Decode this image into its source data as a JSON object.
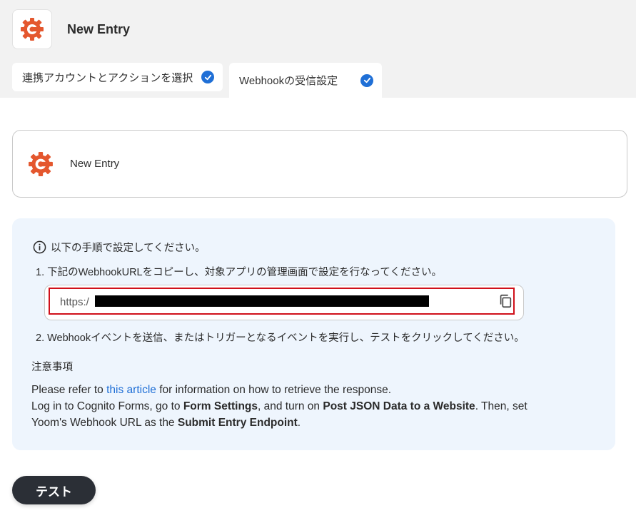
{
  "header": {
    "app_title": "New Entry",
    "brand_color": "#e4572e"
  },
  "tabs": [
    {
      "label": "連携アカウントとアクションを選択",
      "done": true
    },
    {
      "label": "Webhookの受信設定",
      "done": true
    }
  ],
  "trigger_card": {
    "title": "New Entry"
  },
  "instructions": {
    "heading": "以下の手順で設定してください。",
    "step1": "1. 下記のWebhookURLをコピーし、対象アプリの管理画面で設定を行なってください。",
    "url_prefix": "https:/",
    "step2": "2. Webhookイベントを送信、またはトリガーとなるイベントを実行し、テストをクリックしてください。"
  },
  "notes": {
    "title": "注意事項",
    "line1_pre": "Please refer to ",
    "line1_link": "this article",
    "line1_post": " for information on how to retrieve the response.",
    "line2_pre": "Log in to Cognito Forms, go to ",
    "line2_bold1": "Form Settings",
    "line2_mid": ", and turn on ",
    "line2_bold2": "Post JSON Data to a Website",
    "line2_post": ". Then, set",
    "line3_pre": "Yoom's Webhook URL as the ",
    "line3_bold": "Submit Entry Endpoint",
    "line3_post": "."
  },
  "actions": {
    "test_label": "テスト"
  },
  "colors": {
    "accent": "#1f6fd6",
    "highlight_border": "#d0101a",
    "info_bg": "#eef5fd",
    "button_bg": "#2b2f36"
  }
}
